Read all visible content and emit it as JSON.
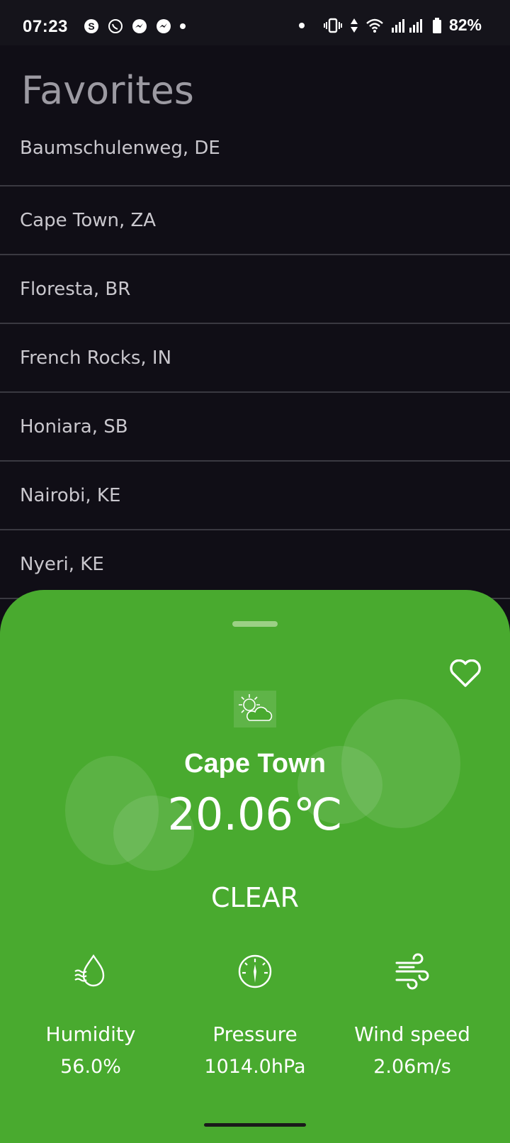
{
  "status_bar": {
    "time": "07:23",
    "battery": "82%",
    "app_icons": [
      "skype-icon",
      "whatsapp-icon",
      "messenger-icon",
      "messenger-icon"
    ]
  },
  "favorites": {
    "title": "Favorites",
    "items": [
      "Baumschulenweg, DE",
      "Cape Town, ZA",
      "Floresta, BR",
      "French Rocks, IN",
      "Honiara, SB",
      "Nairobi, KE",
      "Nyeri, KE"
    ]
  },
  "weather": {
    "city": "Cape Town",
    "temperature": "20.06℃",
    "condition": "CLEAR",
    "icon": "partly-cloudy-icon",
    "accent_color": "#49aa2f",
    "stats": [
      {
        "label": "Humidity",
        "value": "56.0%",
        "icon": "humidity-icon"
      },
      {
        "label": "Pressure",
        "value": "1014.0hPa",
        "icon": "pressure-gauge-icon"
      },
      {
        "label": "Wind speed",
        "value": "2.06m/s",
        "icon": "wind-icon"
      }
    ]
  }
}
